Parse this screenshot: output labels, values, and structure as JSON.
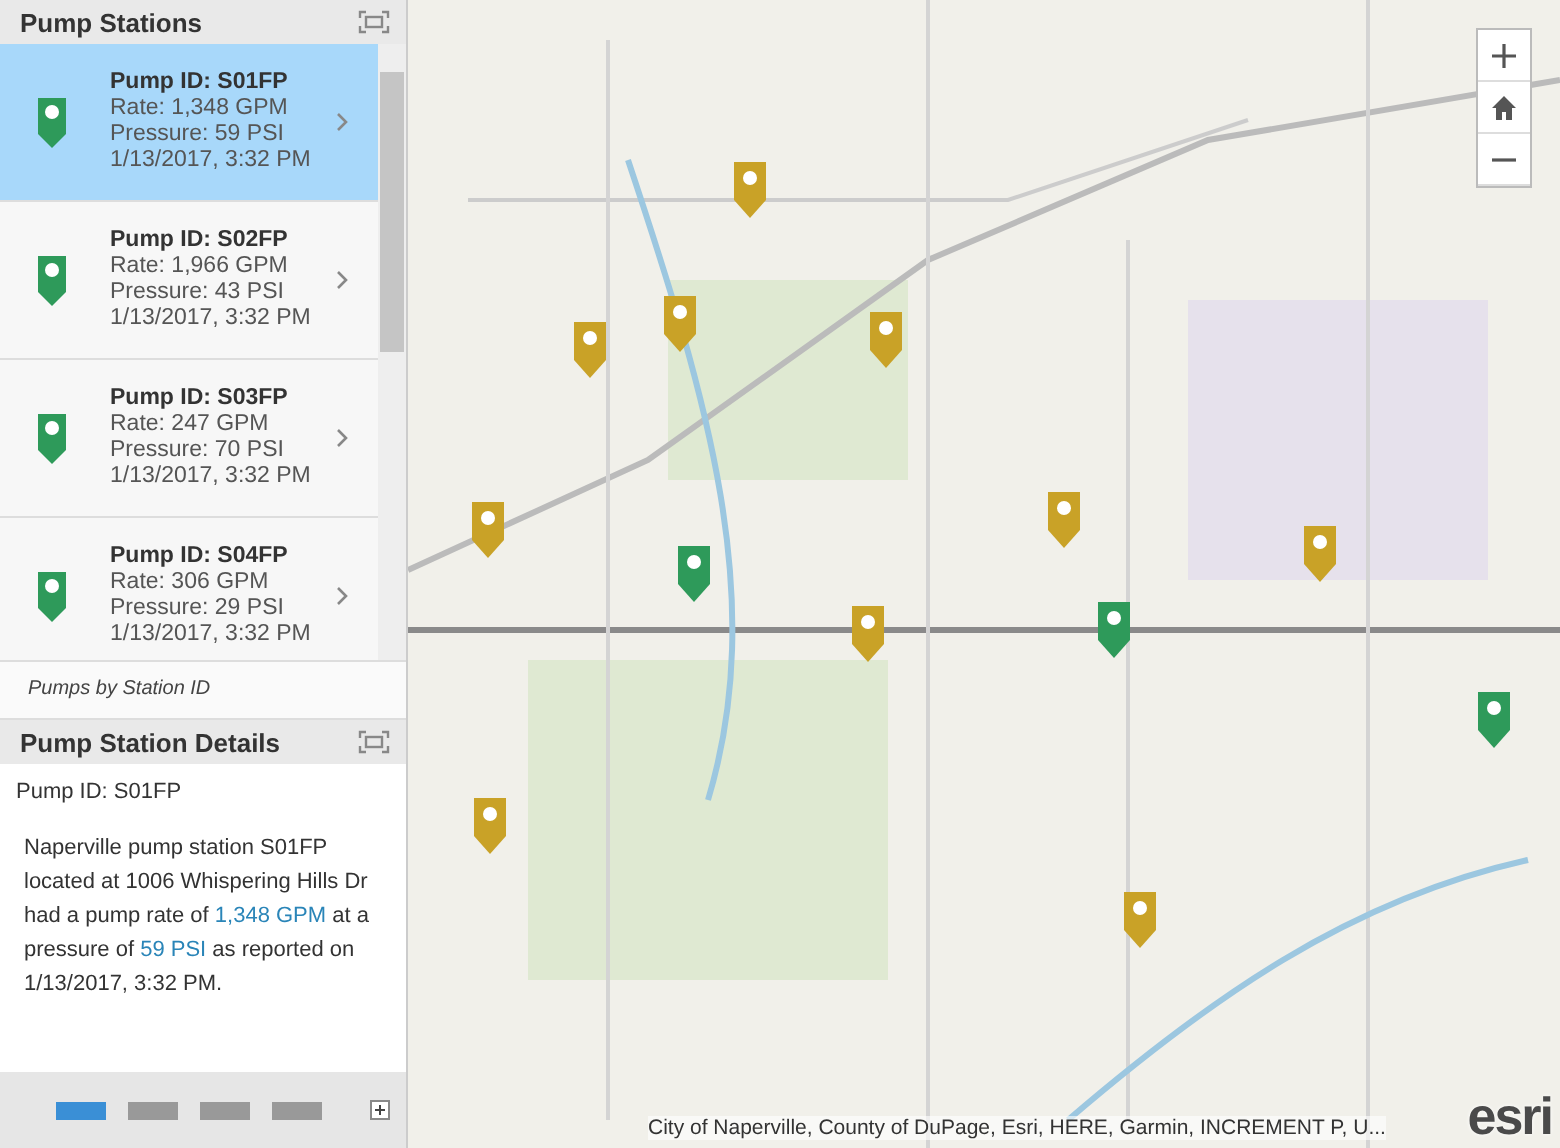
{
  "stations_panel": {
    "title": "Pump Stations",
    "footer": "Pumps by Station ID",
    "items": [
      {
        "title": "Pump ID: S01FP",
        "rate": "Rate: 1,348 GPM",
        "pressure": "Pressure: 59 PSI",
        "time": "1/13/2017, 3:32 PM",
        "selected": true
      },
      {
        "title": "Pump ID: S02FP",
        "rate": "Rate: 1,966 GPM",
        "pressure": "Pressure: 43 PSI",
        "time": "1/13/2017, 3:32 PM",
        "selected": false
      },
      {
        "title": "Pump ID: S03FP",
        "rate": "Rate: 247 GPM",
        "pressure": "Pressure: 70 PSI",
        "time": "1/13/2017, 3:32 PM",
        "selected": false
      },
      {
        "title": "Pump ID: S04FP",
        "rate": "Rate: 306 GPM",
        "pressure": "Pressure: 29 PSI",
        "time": "1/13/2017, 3:32 PM",
        "selected": false
      }
    ]
  },
  "details_panel": {
    "title": "Pump Station Details",
    "pump_id": "Pump ID: S01FP",
    "description": [
      {
        "text": "Naperville pump station S01FP located at 1006 Whispering Hills Dr had a pump rate of ",
        "highlight": false
      },
      {
        "text": "1,348 GPM",
        "highlight": true
      },
      {
        "text": " at a pressure of ",
        "highlight": false
      },
      {
        "text": "59 PSI",
        "highlight": true
      },
      {
        "text": " as reported on 1/13/2017, 3:32 PM.",
        "highlight": false
      }
    ],
    "pages": [
      {
        "selected": true
      },
      {
        "selected": false
      },
      {
        "selected": false
      },
      {
        "selected": false
      }
    ]
  },
  "map": {
    "pins": [
      {
        "color": "#c9a227"
      },
      {
        "color": "#c9a227"
      },
      {
        "color": "#c9a227"
      },
      {
        "color": "#c9a227"
      },
      {
        "color": "#c9a227"
      },
      {
        "color": "#c9a227"
      },
      {
        "color": "#c9a227"
      },
      {
        "color": "#c9a227"
      },
      {
        "color": "#c9a227"
      },
      {
        "color": "#c9a227"
      },
      {
        "color": "#2e9a5a"
      },
      {
        "color": "#2e9a5a"
      },
      {
        "color": "#2e9a5a"
      }
    ],
    "attribution": "City of Naperville, County of DuPage, Esri, HERE, Garmin, INCREMENT P, U...",
    "logo": "esri"
  }
}
